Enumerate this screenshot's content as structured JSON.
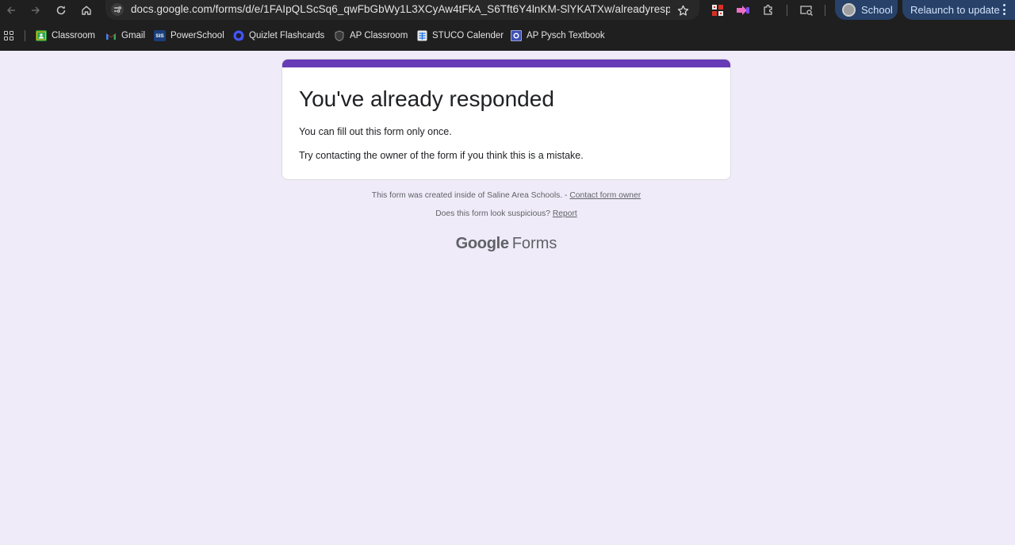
{
  "browser": {
    "url": "docs.google.com/forms/d/e/1FAIpQLScSq6_qwFbGbWy1L3XCyAw4tFkA_S6Tft6Y4lnKM-SlYKATXw/alreadyrespon...",
    "profile_label": "School",
    "relaunch_label": "Relaunch to update",
    "accent_color": "#274168"
  },
  "bookmarks": [
    {
      "label": "Classroom",
      "icon": "google-classroom-icon"
    },
    {
      "label": "Gmail",
      "icon": "gmail-icon"
    },
    {
      "label": "PowerSchool",
      "icon": "powerschool-icon",
      "icon_text": "SIS"
    },
    {
      "label": "Quizlet Flashcards",
      "icon": "quizlet-icon"
    },
    {
      "label": "AP Classroom",
      "icon": "ap-classroom-icon"
    },
    {
      "label": "STUCO Calender",
      "icon": "google-sheets-icon"
    },
    {
      "label": "AP Pysch Textbook",
      "icon": "textbook-icon"
    }
  ],
  "form": {
    "title": "You've already responded",
    "message_1": "You can fill out this form only once.",
    "message_2": "Try contacting the owner of the form if you think this is a mistake.",
    "theme_color": "#673ab7",
    "background_color": "#f0ebf8"
  },
  "footer": {
    "created_text": "This form was created inside of Saline Area Schools. - ",
    "contact_link": "Contact form owner",
    "suspicious_text": "Does this form look suspicious? ",
    "report_link": "Report",
    "logo_google": "Google",
    "logo_forms": "Forms"
  }
}
